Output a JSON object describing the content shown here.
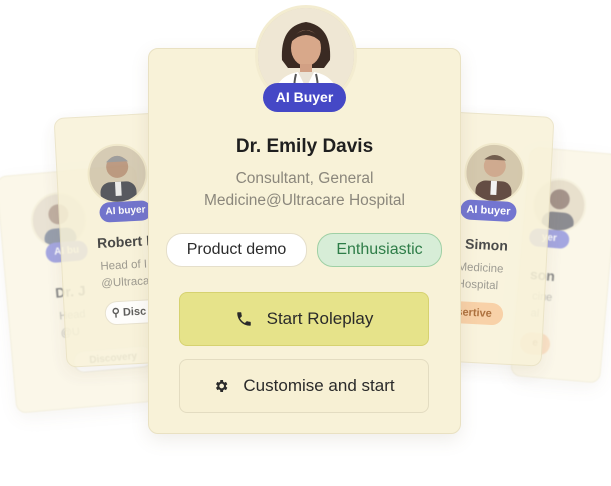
{
  "main_card": {
    "badge": "AI Buyer",
    "name": "Dr. Emily Davis",
    "role_line1": "Consultant, General",
    "role_line2": "Medicine@Ultracare Hospital",
    "tags": [
      "Product demo",
      "Enthusiastic"
    ],
    "primary_button": "Start Roleplay",
    "secondary_button": "Customise and start"
  },
  "left_card_1": {
    "badge": "AI buyer",
    "name": "Robert D",
    "role_line1": "Head of I",
    "role_line2": "@Ultracar",
    "tag": "Disc"
  },
  "left_card_2": {
    "badge": "AI bu",
    "name": "Dr. J",
    "role_line1": "Head",
    "role_line2": "@U",
    "tag": "Discovery"
  },
  "right_card_1": {
    "badge": "AI buyer",
    "name": "h Simon",
    "role_line1": "Medicine",
    "role_line2": "Hospital",
    "tag": "sertive"
  },
  "right_card_2": {
    "badge": "yer",
    "name": "son",
    "role_line1": "cine",
    "role_line2": "al",
    "tag": "e"
  },
  "colors": {
    "card_bg": "#f8f2d8",
    "badge": "#4548c6",
    "primary_button": "#e6e38a",
    "enthusiastic_tag": "#d7edd7",
    "assertive_tag": "#f7c99a"
  }
}
